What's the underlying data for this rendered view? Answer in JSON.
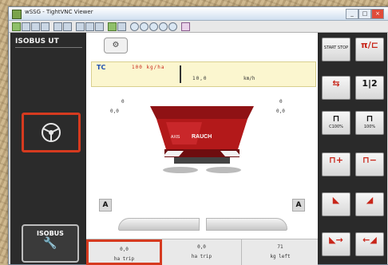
{
  "window": {
    "title": "wSSG - TightVNC Viewer",
    "controls": [
      "_",
      "□",
      "×"
    ]
  },
  "left_panel": {
    "title": "ISOBUS UT",
    "mask_button_icon": "steering-wheel-icon",
    "isobus_button_label": "ISOBUS",
    "isobus_button_icon": "wrench-icon"
  },
  "main": {
    "top_tab_icon": "spreader-disc-icon",
    "tc": {
      "label": "TC",
      "rate": "100 kg/ha",
      "speed": "10,0",
      "speed_unit": "km/h"
    },
    "left_readout": [
      "0",
      "0,0"
    ],
    "right_readout": [
      "0",
      "0,0"
    ],
    "spreader_brand": "AXIS",
    "spreader_model": "RAUCH",
    "left_rate_mode": "A",
    "right_rate_mode": "A",
    "counters": [
      {
        "value": "0,0",
        "label": "ha trip"
      },
      {
        "value": "0,0",
        "label": "ha trip"
      },
      {
        "value": "71",
        "label": "kg left"
      }
    ]
  },
  "softkeys": [
    {
      "label": "START STOP",
      "icon": ""
    },
    {
      "label": "",
      "icon": "tramline-icon"
    },
    {
      "label": "",
      "icon": "section-icon"
    },
    {
      "label": "",
      "icon": "1-2-icon"
    },
    {
      "label": "C100%",
      "icon": "border-left-icon"
    },
    {
      "label": "100%",
      "icon": "border-right-icon"
    },
    {
      "label": "",
      "icon": "plus-left-icon"
    },
    {
      "label": "",
      "icon": "minus-right-icon"
    },
    {
      "label": "",
      "icon": "ramp-left-icon"
    },
    {
      "label": "",
      "icon": "ramp-right-icon"
    },
    {
      "label": "",
      "icon": "arrow-left-icon"
    },
    {
      "label": "",
      "icon": "arrow-right-icon"
    }
  ],
  "colors": {
    "highlight": "#d63a1f",
    "spreader_red": "#b3191a",
    "tc_bg": "#fbf6cf"
  }
}
